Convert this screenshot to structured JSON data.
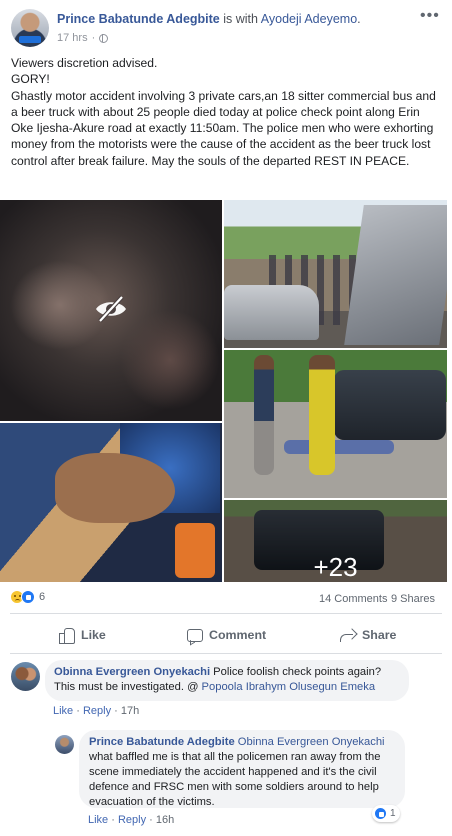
{
  "post": {
    "author": "Prince Babatunde Adegbite",
    "with_text": "is with",
    "tagged": "Ayodeji Adeyemo",
    "period": ".",
    "time": "17 hrs",
    "separator": "·",
    "privacy_icon": "globe-icon",
    "more_icon": "more-options-icon",
    "text_lines": [
      "Viewers discretion advised.",
      "GORY!",
      "Ghastly motor accident involving 3 private cars,an 18 sitter commercial bus and a beer truck with about 25 people died today at police check point along Erin Oke Ijesha-Akure road at exactly 11:50am. The police men who were exhorting money from the motorists were the cause of the accident as the beer truck lost control after break failure. May the souls of the departed REST IN PEACE."
    ],
    "media": {
      "sensitive_icon": "eye-slash-icon",
      "more_photos": "+23"
    },
    "stats": {
      "reaction_icons": [
        "sad-icon",
        "like-icon"
      ],
      "reactions": "6",
      "comments": "14 Comments",
      "shares": "9 Shares"
    },
    "actions": {
      "like": "Like",
      "comment": "Comment",
      "share": "Share"
    }
  },
  "comments": [
    {
      "author": "Obinna Evergreen Onyekachi",
      "text": " Police foolish check points again? This must be investigated. @ ",
      "mention": "Popoola Ibrahym Olusegun Emeka",
      "like": "Like",
      "reply": "Reply",
      "sep": "·",
      "time": "17h"
    },
    {
      "author": "Prince Babatunde Adegbite",
      "mention": "Obinna Evergreen Onyekachi",
      "text": " what baffled me is that all the policemen ran away from the scene immediately the accident happened and it's the civil defence and FRSC men with some soldiers around to help evacuation of the victims.",
      "reaction_count": "1",
      "like": "Like",
      "reply": "Reply",
      "sep": "·",
      "time": "16h"
    }
  ],
  "colors": {
    "link": "#385898",
    "meta": "#90949c",
    "action": "#606770",
    "bubble": "#f2f3f5",
    "like_blue": "#2078f4"
  }
}
